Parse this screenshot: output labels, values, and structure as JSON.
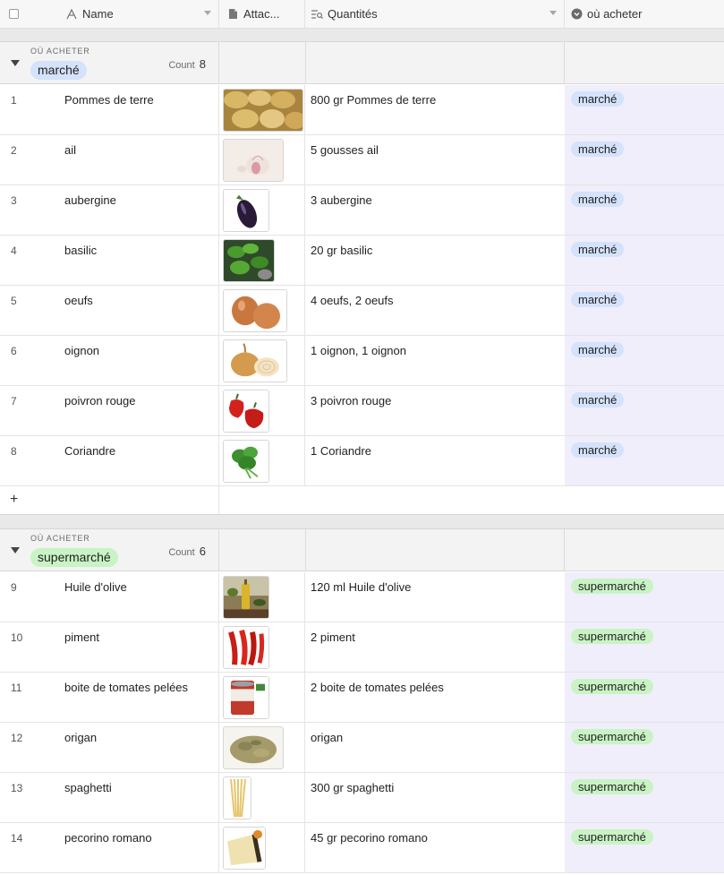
{
  "columns": {
    "name": "Name",
    "attachments": "Attac...",
    "quantities": "Quantités",
    "where": "où acheter"
  },
  "colors": {
    "marche_pill": "#d4e2fb",
    "supermarche_pill": "#c9f3c4",
    "where_column_bg": "#f0eefb"
  },
  "groups": [
    {
      "field_label": "OÙ ACHETER",
      "value": "marché",
      "count_label": "Count",
      "count": "8",
      "add_label": "+",
      "rows": [
        {
          "idx": "1",
          "name": "Pommes de terre",
          "qty": "800 gr Pommes de terre",
          "where": "marché",
          "img": "potatoes"
        },
        {
          "idx": "2",
          "name": "ail",
          "qty": "5 gousses ail",
          "where": "marché",
          "img": "garlic"
        },
        {
          "idx": "3",
          "name": "aubergine",
          "qty": "3  aubergine",
          "where": "marché",
          "img": "eggplant"
        },
        {
          "idx": "4",
          "name": "basilic",
          "qty": "20 gr basilic",
          "where": "marché",
          "img": "basil"
        },
        {
          "idx": "5",
          "name": "oeufs",
          "qty": "4  oeufs, 2  oeufs",
          "where": "marché",
          "img": "eggs"
        },
        {
          "idx": "6",
          "name": "oignon",
          "qty": "1  oignon, 1  oignon",
          "where": "marché",
          "img": "onion"
        },
        {
          "idx": "7",
          "name": "poivron rouge",
          "qty": "3  poivron rouge",
          "where": "marché",
          "img": "pepper"
        },
        {
          "idx": "8",
          "name": "Coriandre",
          "qty": "1  Coriandre",
          "where": "marché",
          "img": "coriander"
        }
      ]
    },
    {
      "field_label": "OÙ ACHETER",
      "value": "supermarché",
      "count_label": "Count",
      "count": "6",
      "rows": [
        {
          "idx": "9",
          "name": "Huile d'olive",
          "qty": "120 ml Huile d'olive",
          "where": "supermarché",
          "img": "oil"
        },
        {
          "idx": "10",
          "name": "piment",
          "qty": "2  piment",
          "where": "supermarché",
          "img": "chili"
        },
        {
          "idx": "11",
          "name": "boite de tomates pelées",
          "qty": "2  boite de tomates pelées",
          "where": "supermarché",
          "img": "tomatocan"
        },
        {
          "idx": "12",
          "name": "origan",
          "qty": "  origan",
          "where": "supermarché",
          "img": "oregano"
        },
        {
          "idx": "13",
          "name": "spaghetti",
          "qty": "300 gr spaghetti",
          "where": "supermarché",
          "img": "spaghetti"
        },
        {
          "idx": "14",
          "name": "pecorino romano",
          "qty": "45 gr pecorino romano",
          "where": "supermarché",
          "img": "cheese"
        }
      ]
    }
  ]
}
